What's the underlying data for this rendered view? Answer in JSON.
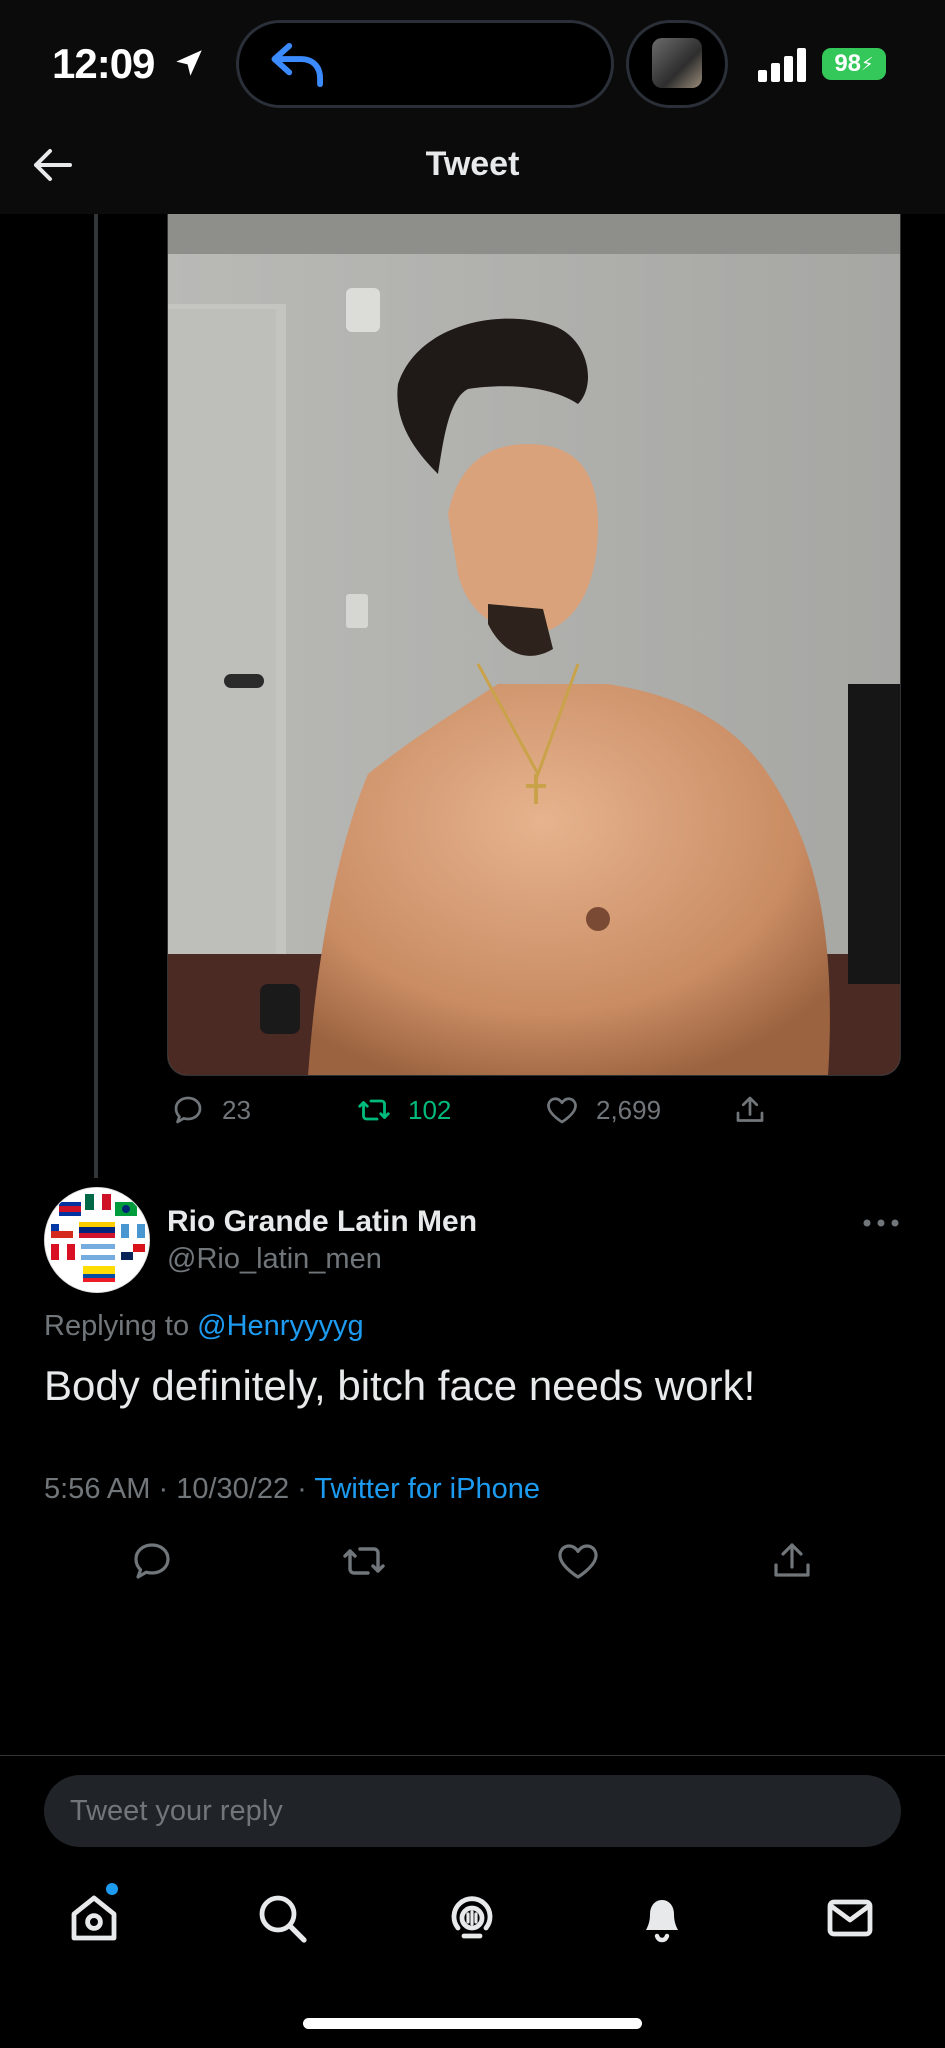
{
  "status_bar": {
    "time": "12:09",
    "battery": "98"
  },
  "header": {
    "title": "Tweet"
  },
  "parent_tweet": {
    "photo_alt": "Shirtless man with gold cross necklace posing in a room",
    "stats": {
      "replies": "23",
      "retweets": "102",
      "likes": "2,699"
    }
  },
  "reply_tweet": {
    "display_name": "Rio Grande Latin Men",
    "handle": "@Rio_latin_men",
    "replying_prefix": "Replying to ",
    "replying_handle": "@Henryyyyg",
    "text": "Body definitely, bitch face needs work!",
    "time": "5:56 AM",
    "date": "10/30/22",
    "source": "Twitter for iPhone",
    "avatar_flags": [
      "Costa Rica",
      "Mexico",
      "Brazil",
      "Chile",
      "Venezuela",
      "Guatemala",
      "Peru",
      "Argentina",
      "Panama",
      "Ecuador"
    ]
  },
  "composer": {
    "placeholder": "Tweet your reply"
  },
  "colors": {
    "accent": "#1d9bf0",
    "retweet": "#00ba7c",
    "muted": "#71767b"
  }
}
